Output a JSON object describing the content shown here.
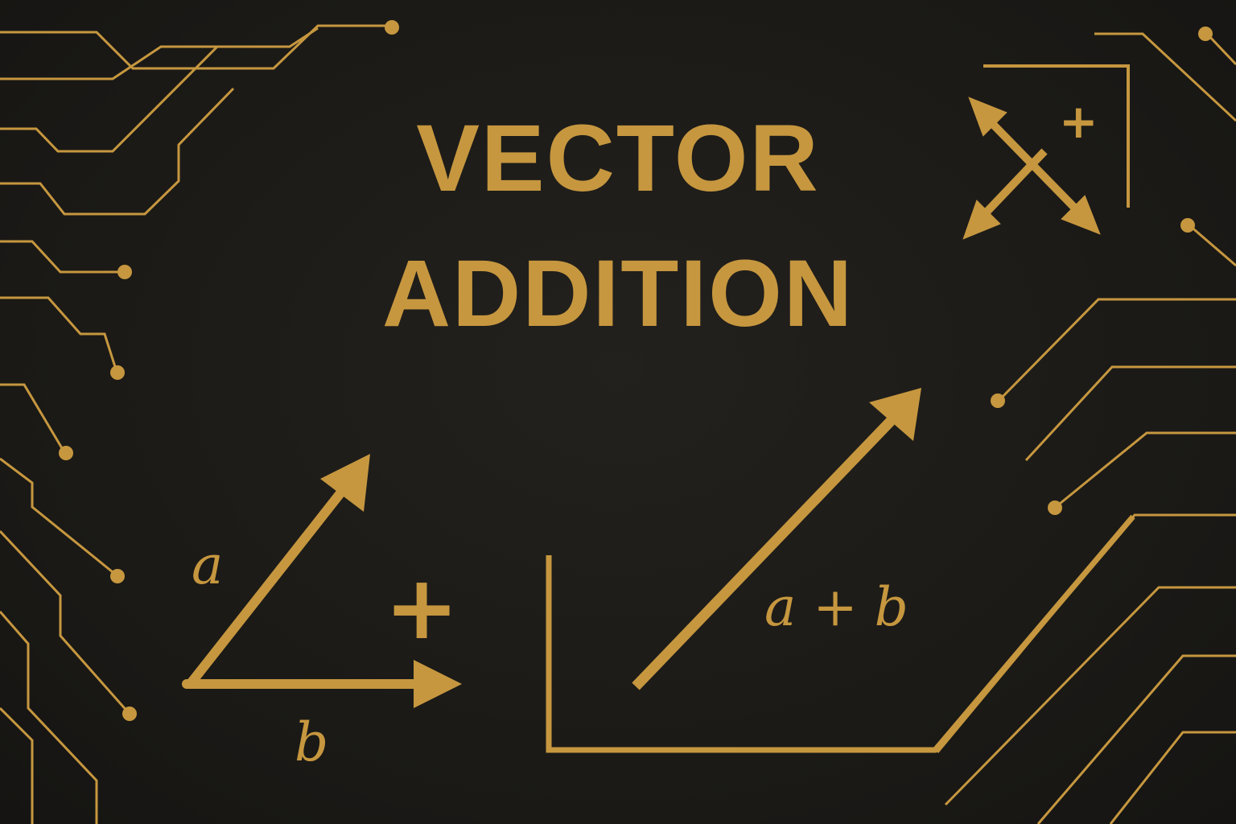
{
  "title": {
    "line1": "VECTOR",
    "line2": "ADDITION"
  },
  "vectors": {
    "a_label": "a",
    "b_label": "b",
    "operator": "+",
    "sum_label": "a + b"
  },
  "icon": {
    "name": "four-direction-arrows-icon",
    "plus": "+"
  },
  "decoration": {
    "name": "circuit-trace-lines"
  },
  "colors": {
    "background": "#1b1a17",
    "accent": "#c6973f"
  }
}
